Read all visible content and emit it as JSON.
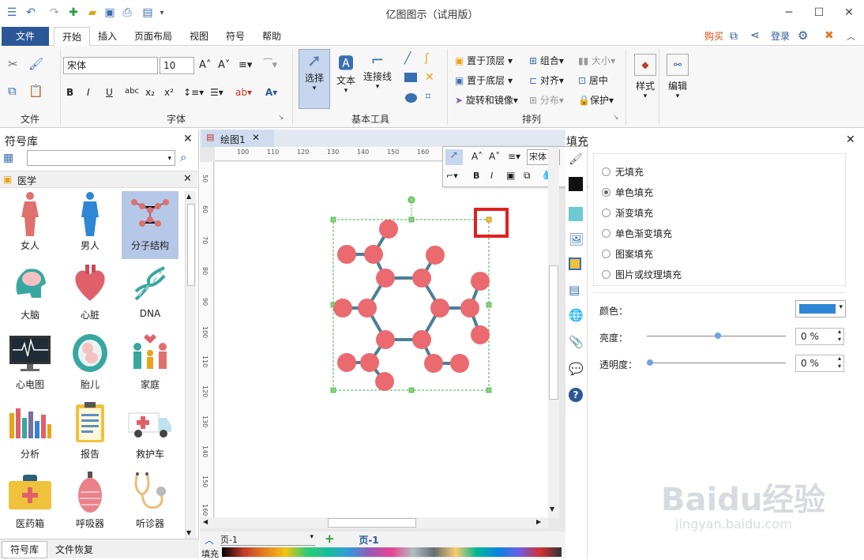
{
  "window": {
    "title": "亿图图示（试用版）"
  },
  "menu": {
    "file": "文件",
    "items": [
      "开始",
      "插入",
      "页面布局",
      "视图",
      "符号",
      "帮助"
    ],
    "right": {
      "buy": "购买",
      "login": "登录"
    }
  },
  "ribbon": {
    "font_name": "宋体",
    "font_size": "10",
    "groups": {
      "file": "文件",
      "font": "字体",
      "basic_tools": "基本工具",
      "arrange": "排列"
    },
    "tools": {
      "select": "选择",
      "text": "文本",
      "connector": "连接线"
    },
    "arrange": {
      "bring_front": "置于顶层",
      "send_back": "置于底层",
      "rotate_mirror": "旋转和镜像",
      "group": "组合",
      "align": "对齐",
      "distribute": "分布",
      "size": "大小",
      "center": "居中",
      "protect": "保护"
    },
    "style": "样式",
    "edit": "编辑"
  },
  "left_panel": {
    "title": "符号库",
    "category": "医学",
    "symbols": [
      "女人",
      "男人",
      "分子结构",
      "大脑",
      "心脏",
      "DNA",
      "心电图",
      "胎儿",
      "家庭",
      "分析",
      "报告",
      "救护车",
      "医药箱",
      "呼吸器",
      "听诊器"
    ],
    "bottom_tabs": [
      "符号库",
      "文件恢复"
    ]
  },
  "document": {
    "tab": "绘图1",
    "ruler_h": [
      "100",
      "110",
      "120",
      "130",
      "140",
      "150",
      "160"
    ],
    "ruler_v": [
      "50",
      "60",
      "70",
      "80",
      "90",
      "100",
      "110",
      "120",
      "130",
      "140",
      "150",
      "160"
    ],
    "mini_font": "宋体"
  },
  "status": {
    "page_select": "页-1",
    "page_tab": "页-1",
    "fill_label": "填充"
  },
  "right_panel": {
    "title": "填充",
    "options": [
      "无填充",
      "单色填充",
      "渐变填充",
      "单色渐变填充",
      "图案填充",
      "图片或纹理填充"
    ],
    "selected_index": 1,
    "color_label": "颜色：",
    "color_value": "#2e86d4",
    "brightness_label": "亮度：",
    "brightness_value": "0 %",
    "transparency_label": "透明度：",
    "transparency_value": "0 %"
  },
  "watermark": {
    "brand": "Baidu经验",
    "url": "jingyan.baidu.com"
  }
}
